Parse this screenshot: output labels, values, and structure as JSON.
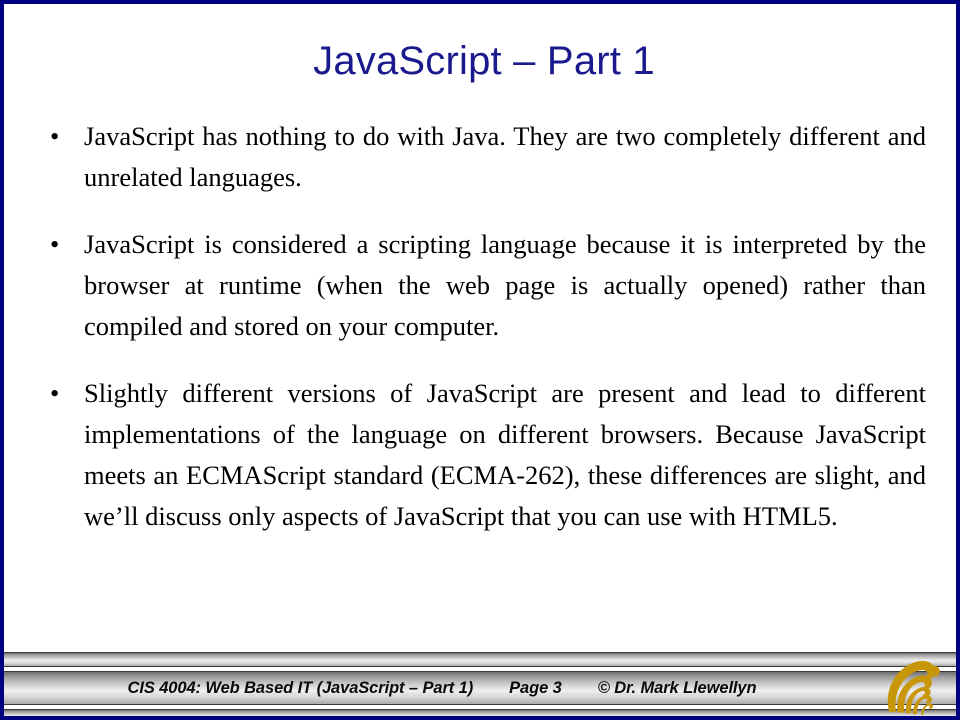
{
  "slide": {
    "title": "JavaScript – Part 1",
    "title_color": "#1a1a8e",
    "border_color": "#000080",
    "background_color": "#ffffff",
    "bullet_marker": "•",
    "bullets": [
      "JavaScript has nothing to do with Java.  They are two completely different and unrelated languages.",
      "JavaScript is considered a scripting language because it is interpreted by the browser at runtime (when the web page is actually opened) rather than compiled and stored on your computer.",
      "Slightly different versions of JavaScript are present and lead to different implementations of the language on different browsers.  Because JavaScript meets an ECMAScript standard (ECMA-262), these differences are slight, and we’ll discuss only aspects of JavaScript that you can use with HTML5."
    ]
  },
  "footer": {
    "course": "CIS 4004: Web Based IT (JavaScript – Part 1)",
    "page": "Page 3",
    "copyright": "© Dr. Mark Llewellyn",
    "logo_name": "ucf-pegasus-logo",
    "logo_color": "#C8960A"
  }
}
